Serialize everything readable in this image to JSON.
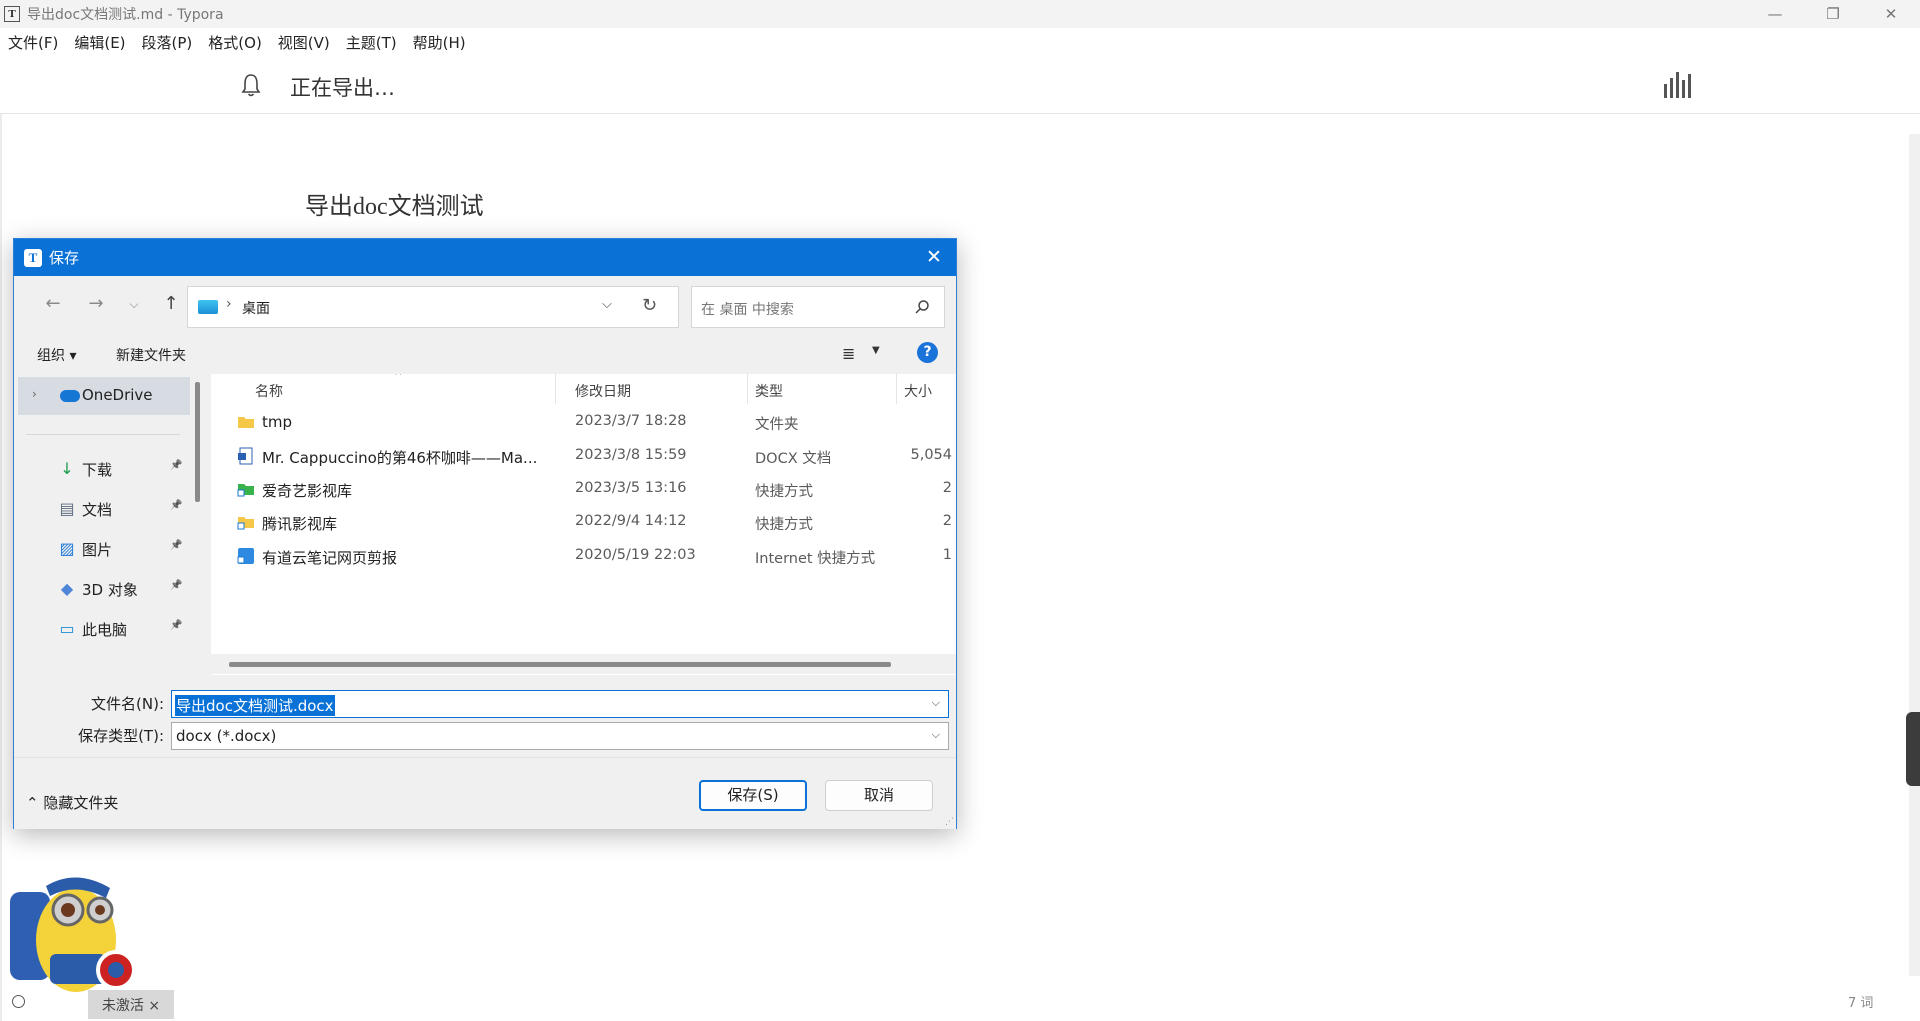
{
  "window": {
    "title": "导出doc文档测试.md - Typora",
    "app_icon": "T",
    "controls": [
      "—",
      "❐",
      "✕"
    ]
  },
  "menu": [
    "文件(F)",
    "编辑(E)",
    "段落(P)",
    "格式(O)",
    "视图(V)",
    "主题(T)",
    "帮助(H)"
  ],
  "notify": {
    "text": "正在导出…",
    "icon": "bell-icon"
  },
  "document": {
    "heading": "导出doc文档测试",
    "word_count": "7 词"
  },
  "dialog": {
    "title": "保存",
    "app_icon": "T",
    "address": {
      "location": "桌面"
    },
    "search": {
      "placeholder": "在 桌面 中搜索"
    },
    "commands": {
      "organize": "组织 ▾",
      "new_folder": "新建文件夹",
      "help": "?"
    },
    "nav": {
      "onedrive": "OneDrive",
      "items": [
        {
          "label": "下载",
          "icon": "download-icon",
          "glyph": "↓",
          "color": "#1a9e4b"
        },
        {
          "label": "文档",
          "icon": "documents-icon",
          "glyph": "▤",
          "color": "#5b6b7e"
        },
        {
          "label": "图片",
          "icon": "pictures-icon",
          "glyph": "▨",
          "color": "#1f7ad6"
        },
        {
          "label": "3D 对象",
          "icon": "3d-objects-icon",
          "glyph": "◆",
          "color": "#4f86d8"
        },
        {
          "label": "此电脑",
          "icon": "this-pc-icon",
          "glyph": "▭",
          "color": "#1a8fd6"
        }
      ]
    },
    "columns": {
      "name": "名称",
      "modified": "修改日期",
      "type": "类型",
      "size": "大小"
    },
    "files": [
      {
        "name": "tmp",
        "modified": "2023/3/7 18:28",
        "type": "文件夹",
        "size": "",
        "icon": "folder-icon"
      },
      {
        "name": "Mr. Cappuccino的第46杯咖啡——Ma...",
        "modified": "2023/3/8 15:59",
        "type": "DOCX 文档",
        "size": "5,054",
        "icon": "docx-icon"
      },
      {
        "name": "爱奇艺影视库",
        "modified": "2023/3/5 13:16",
        "type": "快捷方式",
        "size": "2",
        "icon": "iqiyi-shortcut-icon"
      },
      {
        "name": "腾讯影视库",
        "modified": "2022/9/4 14:12",
        "type": "快捷方式",
        "size": "2",
        "icon": "tencent-shortcut-icon"
      },
      {
        "name": "有道云笔记网页剪报",
        "modified": "2020/5/19 22:03",
        "type": "Internet 快捷方式",
        "size": "1",
        "icon": "youdao-shortcut-icon"
      }
    ],
    "filename_label": "文件名(N):",
    "filename_value": "导出doc文档测试.docx",
    "filetype_label": "保存类型(T):",
    "filetype_value": "docx (*.docx)",
    "hide_folders": "隐藏文件夹",
    "save_button": "保存(S)",
    "cancel_button": "取消"
  },
  "taskbar": {
    "activate_tab": "未激活 ×"
  },
  "colors": {
    "accent": "#0a72d6",
    "selection": "#d7dce3"
  }
}
